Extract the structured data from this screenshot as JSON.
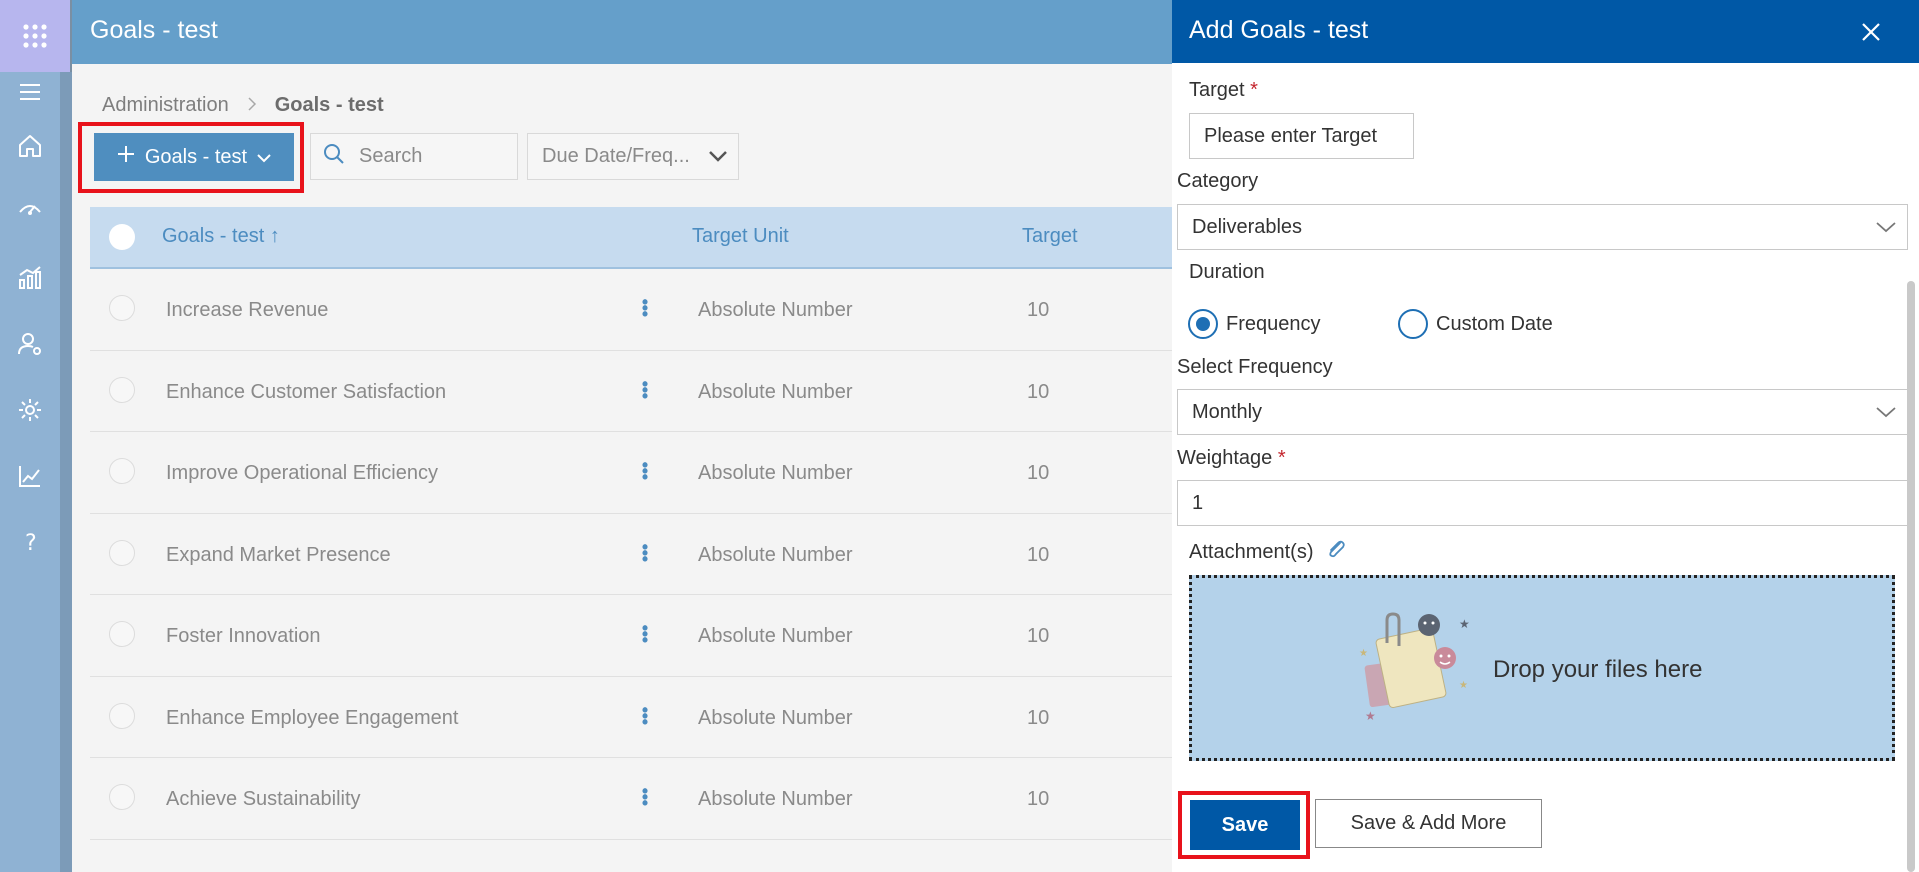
{
  "app": {
    "title": "Goals - test"
  },
  "breadcrumb": {
    "parent": "Administration",
    "current": "Goals - test"
  },
  "toolbar": {
    "add_label": "Goals - test",
    "search_placeholder": "Search",
    "due_filter": "Due Date/Freq..."
  },
  "table": {
    "columns": [
      "Goals - test ↑",
      "Target Unit",
      "Target"
    ],
    "rows": [
      {
        "name": "Increase Revenue",
        "unit": "Absolute Number",
        "target": "10"
      },
      {
        "name": "Enhance Customer Satisfaction",
        "unit": "Absolute Number",
        "target": "10"
      },
      {
        "name": "Improve Operational Efficiency",
        "unit": "Absolute Number",
        "target": "10"
      },
      {
        "name": "Expand Market Presence",
        "unit": "Absolute Number",
        "target": "10"
      },
      {
        "name": "Foster Innovation",
        "unit": "Absolute Number",
        "target": "10"
      },
      {
        "name": "Enhance Employee Engagement",
        "unit": "Absolute Number",
        "target": "10"
      },
      {
        "name": "Achieve Sustainability",
        "unit": "Absolute Number",
        "target": "10"
      }
    ]
  },
  "panel": {
    "title": "Add Goals - test",
    "target_label": "Target",
    "target_placeholder": "Please enter Target",
    "category_label": "Category",
    "category_value": "Deliverables",
    "duration_label": "Duration",
    "duration_options": [
      "Frequency",
      "Custom Date"
    ],
    "duration_selected": "Frequency",
    "frequency_label": "Select Frequency",
    "frequency_value": "Monthly",
    "weightage_label": "Weightage",
    "weightage_value": "1",
    "attachments_label": "Attachment(s)",
    "drop_text": "Drop your files here",
    "save_label": "Save",
    "save_more_label": "Save & Add More",
    "required_mark": "*"
  },
  "colors": {
    "rail": "#8fb2d3",
    "topbar": "#659fca",
    "panel_header": "#0058a6",
    "highlight": "#e8121b",
    "drop_zone": "#b4d2ea"
  },
  "icons": {
    "rail": [
      "waffle-icon",
      "hamburger-icon",
      "home-icon",
      "gauge-icon",
      "analytics-icon",
      "user-settings-icon",
      "gear-icon",
      "trend-icon",
      "help-icon"
    ]
  }
}
